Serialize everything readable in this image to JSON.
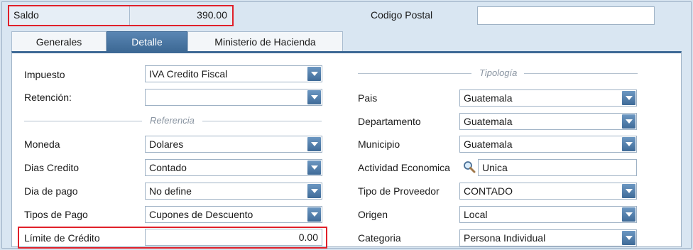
{
  "saldo": {
    "label": "Saldo",
    "value": "390.00"
  },
  "codigo_postal": {
    "label": "Codigo Postal",
    "value": ""
  },
  "tabs": [
    {
      "label": "Generales",
      "active": false
    },
    {
      "label": "Detalle",
      "active": true
    },
    {
      "label": "Ministerio de Hacienda",
      "active": false
    }
  ],
  "left": {
    "impuesto": {
      "label": "Impuesto",
      "value": "IVA Credito Fiscal"
    },
    "retencion": {
      "label": "Retención:",
      "value": ""
    },
    "referencia_title": "Referencia",
    "moneda": {
      "label": "Moneda",
      "value": "Dolares"
    },
    "dias_credito": {
      "label": "Dias Credito",
      "value": "Contado"
    },
    "dia_pago": {
      "label": "Dia de pago",
      "value": "No define"
    },
    "tipos_pago": {
      "label": "Tipos de Pago",
      "value": "Cupones de Descuento"
    },
    "limite_credito": {
      "label": "Límite de Crédito",
      "value": "0.00"
    }
  },
  "right": {
    "tipologia_title": "Tipología",
    "pais": {
      "label": "Pais",
      "value": "Guatemala"
    },
    "departamento": {
      "label": "Departamento",
      "value": "Guatemala"
    },
    "municipio": {
      "label": "Municipio",
      "value": "Guatemala"
    },
    "actividad": {
      "label": "Actividad Economica",
      "value": "Unica"
    },
    "tipo_proveedor": {
      "label": "Tipo de Proveedor",
      "value": "CONTADO"
    },
    "origen": {
      "label": "Origen",
      "value": "Local"
    },
    "categoria": {
      "label": "Categoria",
      "value": "Persona Individual"
    }
  },
  "colors": {
    "highlight": "#e0202a",
    "tab_active": "#3d6995",
    "background": "#d6e3ef"
  },
  "icons": {
    "actividad_lookup": "search-icon",
    "dropdown": "chevron-down-icon"
  }
}
